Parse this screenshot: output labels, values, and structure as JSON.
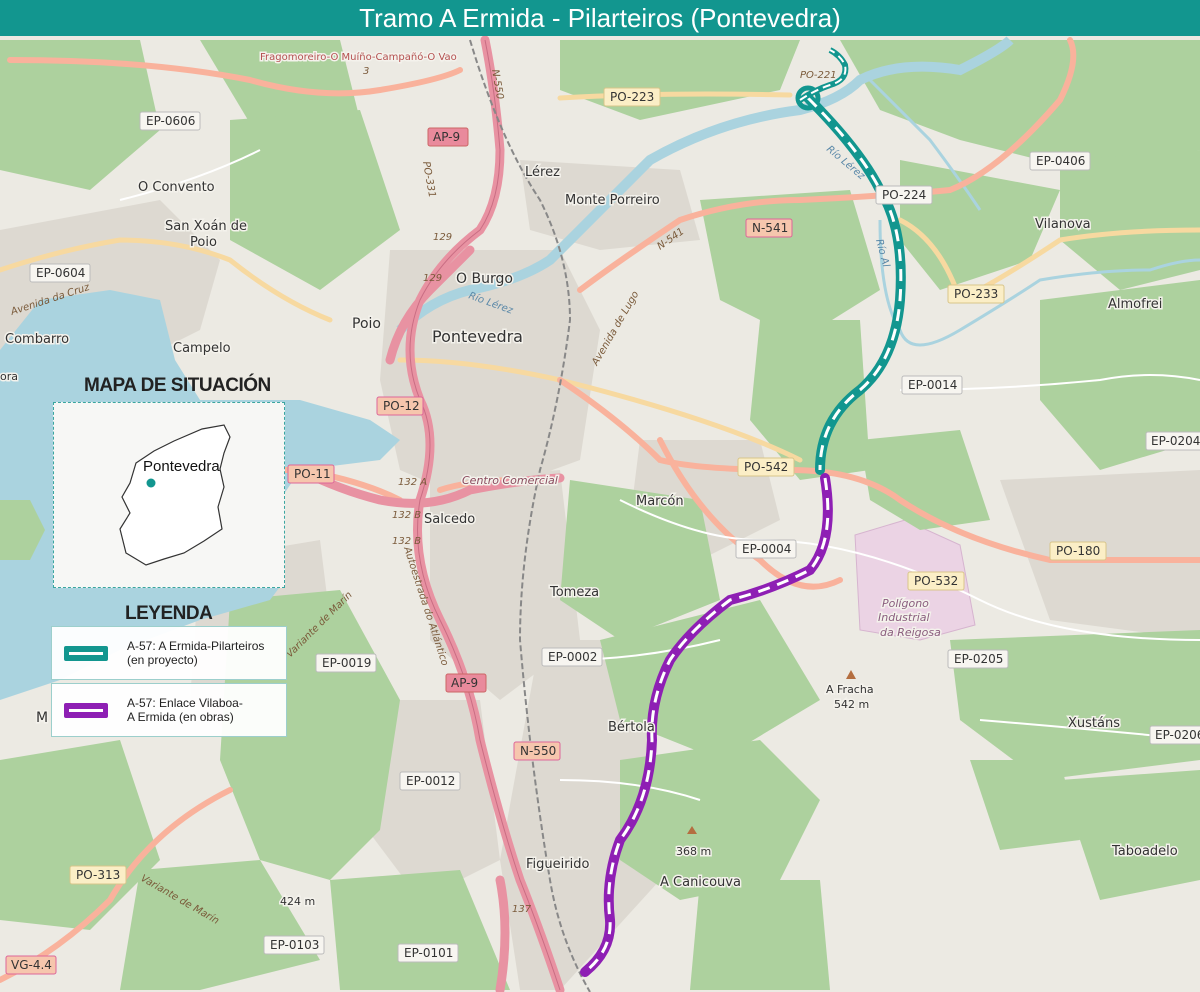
{
  "title": "Tramo A Ermida - Pilarteiros (Pontevedra)",
  "situation_map": {
    "heading": "MAPA DE SITUACIÓN",
    "city_label": "Pontevedra"
  },
  "legend": {
    "heading": "LEYENDA",
    "items": [
      {
        "label_line1": "A-57: A Ermida-Pilarteiros",
        "label_line2": "(en proyecto)",
        "color": "#12968f"
      },
      {
        "label_line1": "A-57: Enlace Vilaboa-",
        "label_line2": "A Ermida (en obras)",
        "color": "#8e1fb4"
      }
    ]
  },
  "places": {
    "fragomoreiro": "Fragomoreiro-O Muíño-Campañó-O Vao",
    "o_convento": "O Convento",
    "san_xoan": "San Xoán de",
    "poio_1": "Poio",
    "combarro": "Combarro",
    "campelo": "Campelo",
    "poio": "Poio",
    "lerez": "Lérez",
    "monte_porreiro": "Monte Porreiro",
    "o_burgo": "O Burgo",
    "pontevedra": "Pontevedra",
    "vilanova": "Vilanova",
    "almofrei": "Almofrei",
    "marcon": "Marcón",
    "salcedo": "Salcedo",
    "tomeza": "Tomeza",
    "bertola": "Bértola",
    "figueirido": "Figueirido",
    "a_canicouva": "A Canicouva",
    "xustans": "Xustáns",
    "taboadelo": "Taboadelo",
    "a_fracha": "A Fracha",
    "a_fracha_alt": "542 m",
    "alt_368": "368 m",
    "alt_424": "424 m",
    "poligono_1": "Polígono",
    "poligono_2": "Industrial",
    "poligono_3": "da Reigosa",
    "centro_comercial": "Centro Comercial",
    "ora": "ora",
    "m_letter": "M"
  },
  "roads": {
    "ep0606": "EP-0606",
    "ep0604": "EP-0604",
    "po223": "PO-223",
    "ap9_top": "AP-9",
    "n541": "N-541",
    "po224": "PO-224",
    "ep0406": "EP-0406",
    "po233": "PO-233",
    "ep0014": "EP-0014",
    "ep0204": "EP-0204",
    "po12": "PO-12",
    "po11": "PO-11",
    "po542": "PO-542",
    "ep0004": "EP-0004",
    "po180": "PO-180",
    "po532": "PO-532",
    "ep0205": "EP-0205",
    "ep0019": "EP-0019",
    "ep0002": "EP-0002",
    "ap9_bottom": "AP-9",
    "ep0206": "EP-0206",
    "n550": "N-550",
    "ep0012": "EP-0012",
    "po313": "PO-313",
    "ep0103": "EP-0103",
    "ep0101": "EP-0101",
    "vg44": "VG-4.4"
  },
  "road_labels": {
    "n550_vert": "N-550",
    "po331": "PO-331",
    "n541_diag": "N-541",
    "avenida_lugo": "Avenida de Lugo",
    "avenida_cruz": "Avenida da Cruz",
    "variante_marin_1": "Variante de Marín",
    "variante_marin_2": "Variante de Marín",
    "autoestrada": "Autoestrada do Atlántico",
    "rio_lerez_1": "Río Lérez",
    "rio_lerez_2": "Río Lérez",
    "rio_almofrei": "Río Al",
    "exit_129a": "129",
    "exit_129b": "129",
    "exit_132a": "132 A",
    "exit_132b1": "132 B",
    "exit_132b2": "132 B",
    "exit_137": "137",
    "po221": "PO-221",
    "km3": "3"
  },
  "colors": {
    "title_bar": "#12968f",
    "route_project": "#12968f",
    "route_works": "#8e1fb4",
    "water": "#aad3df",
    "forest": "#add19e",
    "motorway": "#e892a2",
    "primary": "#f9b29c",
    "secondary": "#f7d9a0",
    "land": "#eceae3"
  }
}
